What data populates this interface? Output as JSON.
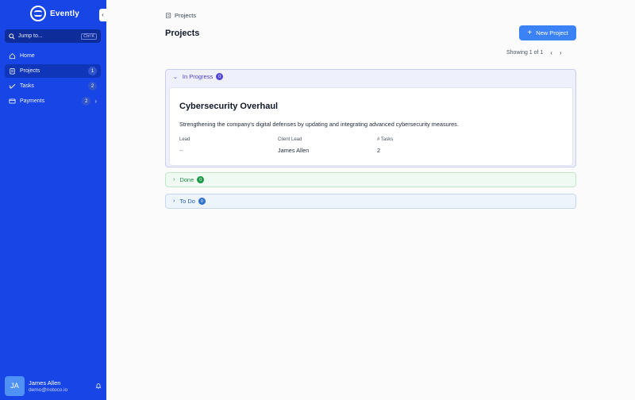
{
  "app": {
    "name": "Evently"
  },
  "sidebar": {
    "collapse_icon": "chevron-left-icon",
    "jump": {
      "label": "Jump to...",
      "shortcut": "Ctrl K"
    },
    "items": [
      {
        "label": "Home",
        "icon": "home-icon",
        "badge": ""
      },
      {
        "label": "Projects",
        "icon": "projects-icon",
        "badge": "1",
        "active": true
      },
      {
        "label": "Tasks",
        "icon": "tasks-icon",
        "badge": "2"
      },
      {
        "label": "Payments",
        "icon": "payments-icon",
        "badge": "2",
        "has_submenu": true
      }
    ],
    "user": {
      "initials": "JA",
      "name": "James Allen",
      "email": "demo@notoco.io"
    }
  },
  "header": {
    "breadcrumb": "Projects",
    "title": "Projects",
    "new_button": "New Project",
    "pagination": "Showing 1 of 1"
  },
  "groups": [
    {
      "label": "In Progress",
      "count": "0",
      "expanded": true,
      "projects": [
        {
          "title": "Cybersecurity Overhaul",
          "description": "Strengthening the company's digital defenses by updating and integrating advanced cybersecurity measures.",
          "fields": [
            {
              "label": "Lead",
              "value": "--"
            },
            {
              "label": "Client Lead",
              "value": "James Allen"
            },
            {
              "label": "# Tasks",
              "value": "2"
            }
          ]
        }
      ]
    },
    {
      "label": "Done",
      "count": "0",
      "expanded": false
    },
    {
      "label": "To Do",
      "count": "0",
      "expanded": false
    }
  ],
  "colors": {
    "sidebar": "#1846e6",
    "primary_button": "#3b82f6",
    "in_progress": "#5446d9",
    "done": "#1c9a48",
    "todo": "#2f6fd0"
  }
}
